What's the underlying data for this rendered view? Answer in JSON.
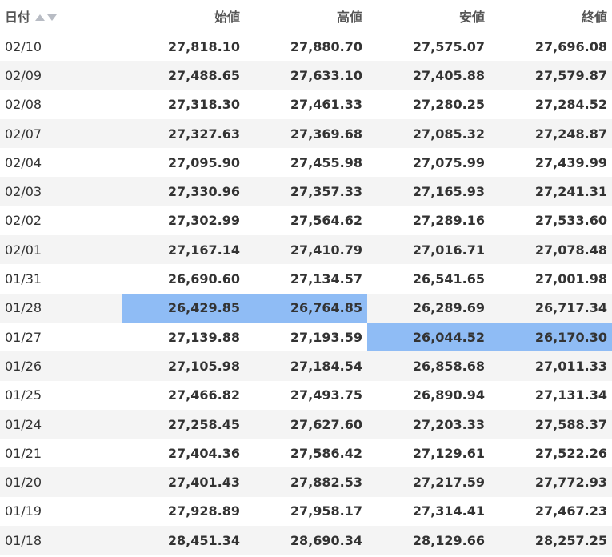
{
  "table": {
    "columns": [
      "日付",
      "始値",
      "高値",
      "安値",
      "終値"
    ],
    "sort_icons": [
      "sort-ascending-icon",
      "sort-descending-icon"
    ],
    "highlight_color": "#8fbcf5",
    "highlighted_cells": [
      {
        "row": "01/28",
        "column": "始値"
      },
      {
        "row": "01/28",
        "column": "高値"
      },
      {
        "row": "01/27",
        "column": "安値"
      },
      {
        "row": "01/27",
        "column": "終値"
      }
    ],
    "rows": [
      {
        "date": "02/10",
        "open": "27,818.10",
        "high": "27,880.70",
        "low": "27,575.07",
        "close": "27,696.08"
      },
      {
        "date": "02/09",
        "open": "27,488.65",
        "high": "27,633.10",
        "low": "27,405.88",
        "close": "27,579.87"
      },
      {
        "date": "02/08",
        "open": "27,318.30",
        "high": "27,461.33",
        "low": "27,280.25",
        "close": "27,284.52"
      },
      {
        "date": "02/07",
        "open": "27,327.63",
        "high": "27,369.68",
        "low": "27,085.32",
        "close": "27,248.87"
      },
      {
        "date": "02/04",
        "open": "27,095.90",
        "high": "27,455.98",
        "low": "27,075.99",
        "close": "27,439.99"
      },
      {
        "date": "02/03",
        "open": "27,330.96",
        "high": "27,357.33",
        "low": "27,165.93",
        "close": "27,241.31"
      },
      {
        "date": "02/02",
        "open": "27,302.99",
        "high": "27,564.62",
        "low": "27,289.16",
        "close": "27,533.60"
      },
      {
        "date": "02/01",
        "open": "27,167.14",
        "high": "27,410.79",
        "low": "27,016.71",
        "close": "27,078.48"
      },
      {
        "date": "01/31",
        "open": "26,690.60",
        "high": "27,134.57",
        "low": "26,541.65",
        "close": "27,001.98"
      },
      {
        "date": "01/28",
        "open": "26,429.85",
        "high": "26,764.85",
        "low": "26,289.69",
        "close": "26,717.34"
      },
      {
        "date": "01/27",
        "open": "27,139.88",
        "high": "27,193.59",
        "low": "26,044.52",
        "close": "26,170.30"
      },
      {
        "date": "01/26",
        "open": "27,105.98",
        "high": "27,184.54",
        "low": "26,858.68",
        "close": "27,011.33"
      },
      {
        "date": "01/25",
        "open": "27,466.82",
        "high": "27,493.75",
        "low": "26,890.94",
        "close": "27,131.34"
      },
      {
        "date": "01/24",
        "open": "27,258.45",
        "high": "27,627.60",
        "low": "27,203.33",
        "close": "27,588.37"
      },
      {
        "date": "01/21",
        "open": "27,404.36",
        "high": "27,586.42",
        "low": "27,129.61",
        "close": "27,522.26"
      },
      {
        "date": "01/20",
        "open": "27,401.43",
        "high": "27,882.53",
        "low": "27,217.59",
        "close": "27,772.93"
      },
      {
        "date": "01/19",
        "open": "27,928.89",
        "high": "27,958.17",
        "low": "27,314.41",
        "close": "27,467.23"
      },
      {
        "date": "01/18",
        "open": "28,451.34",
        "high": "28,690.34",
        "low": "28,129.66",
        "close": "28,257.25"
      }
    ]
  }
}
